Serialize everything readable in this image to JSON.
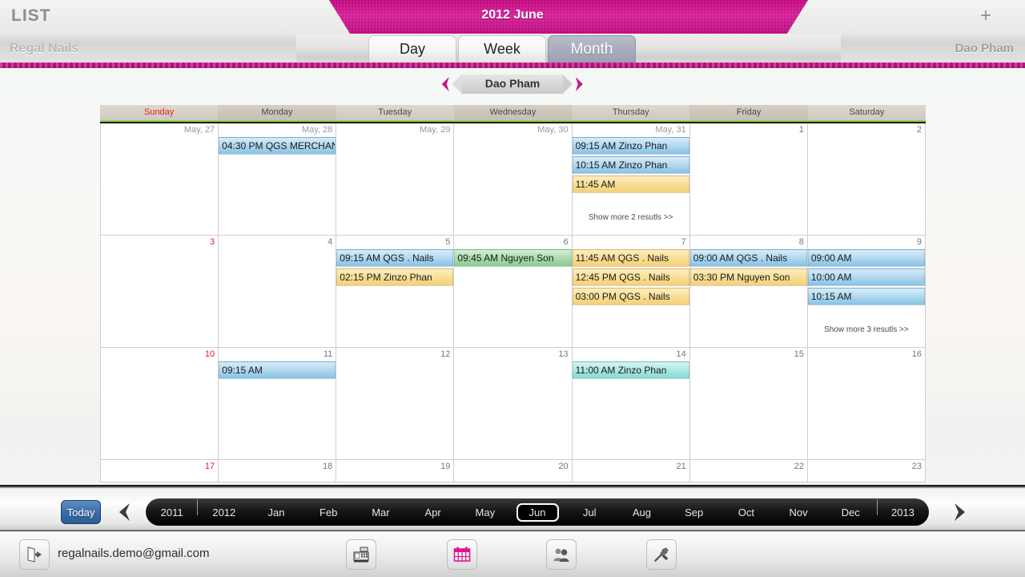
{
  "header": {
    "list_label": "LIST",
    "month_title": "2012 June",
    "add_label": "+",
    "brand": "Regal Nails",
    "user": "Dao Pham",
    "tabs": [
      {
        "label": "Day",
        "active": false
      },
      {
        "label": "Week",
        "active": false
      },
      {
        "label": "Month",
        "active": true
      }
    ]
  },
  "employee_nav": {
    "prev_icon": "chevron-left-icon",
    "next_icon": "chevron-right-icon",
    "name": "Dao Pham"
  },
  "calendar": {
    "day_headers": [
      "Sunday",
      "Monday",
      "Tuesday",
      "Wednesday",
      "Thursday",
      "Friday",
      "Saturday"
    ],
    "weeks": [
      {
        "days": [
          {
            "num": "May, 27",
            "style": "prev",
            "events": [],
            "more": null
          },
          {
            "num": "May, 28",
            "style": "prev",
            "events": [
              {
                "text": "04:30 PM QGS MERCHAN",
                "color": "blue"
              }
            ],
            "more": null
          },
          {
            "num": "May, 29",
            "style": "prev",
            "events": [],
            "more": null
          },
          {
            "num": "May, 30",
            "style": "prev",
            "events": [],
            "more": null
          },
          {
            "num": "May, 31",
            "style": "prev",
            "events": [
              {
                "text": "09:15 AM Zinzo Phan",
                "color": "blue"
              },
              {
                "text": "10:15 AM Zinzo Phan",
                "color": "blue"
              },
              {
                "text": "11:45 AM",
                "color": "yellow"
              }
            ],
            "more": "Show more 2 resutls >>"
          },
          {
            "num": "1",
            "style": "normal",
            "events": [],
            "more": null
          },
          {
            "num": "2",
            "style": "normal",
            "events": [],
            "more": null
          }
        ]
      },
      {
        "days": [
          {
            "num": "3",
            "style": "red",
            "events": [],
            "more": null
          },
          {
            "num": "4",
            "style": "normal",
            "events": [],
            "more": null
          },
          {
            "num": "5",
            "style": "normal",
            "events": [
              {
                "text": "09:15 AM QGS . Nails",
                "color": "blue"
              },
              {
                "text": "02:15 PM Zinzo Phan",
                "color": "yellow"
              }
            ],
            "more": null
          },
          {
            "num": "6",
            "style": "normal",
            "events": [
              {
                "text": "09:45 AM Nguyen Son",
                "color": "green"
              }
            ],
            "more": null
          },
          {
            "num": "7",
            "style": "normal",
            "events": [
              {
                "text": "11:45 AM QGS . Nails",
                "color": "yellow"
              },
              {
                "text": "12:45 PM QGS . Nails",
                "color": "yellow"
              },
              {
                "text": "03:00 PM QGS . Nails",
                "color": "yellow"
              }
            ],
            "more": null
          },
          {
            "num": "8",
            "style": "normal",
            "events": [
              {
                "text": "09:00 AM QGS . Nails",
                "color": "blue"
              },
              {
                "text": "03:30 PM Nguyen Son",
                "color": "yellow"
              }
            ],
            "more": null
          },
          {
            "num": "9",
            "style": "normal",
            "events": [
              {
                "text": "09:00 AM",
                "color": "blue"
              },
              {
                "text": "10:00 AM",
                "color": "blue"
              },
              {
                "text": "10:15 AM",
                "color": "blue"
              }
            ],
            "more": "Show more 3 resutls >>"
          }
        ]
      },
      {
        "days": [
          {
            "num": "10",
            "style": "red",
            "events": [],
            "more": null
          },
          {
            "num": "11",
            "style": "normal",
            "events": [
              {
                "text": "09:15 AM",
                "color": "blue"
              }
            ],
            "more": null
          },
          {
            "num": "12",
            "style": "normal",
            "events": [],
            "more": null
          },
          {
            "num": "13",
            "style": "normal",
            "events": [],
            "more": null
          },
          {
            "num": "14",
            "style": "normal",
            "events": [
              {
                "text": "11:00 AM Zinzo Phan",
                "color": "cyan"
              }
            ],
            "more": null
          },
          {
            "num": "15",
            "style": "normal",
            "events": [],
            "more": null
          },
          {
            "num": "16",
            "style": "normal",
            "events": [],
            "more": null
          }
        ]
      },
      {
        "days": [
          {
            "num": "17",
            "style": "red",
            "events": [],
            "more": null
          },
          {
            "num": "18",
            "style": "normal",
            "events": [],
            "more": null
          },
          {
            "num": "19",
            "style": "normal",
            "events": [],
            "more": null
          },
          {
            "num": "20",
            "style": "normal",
            "events": [],
            "more": null
          },
          {
            "num": "21",
            "style": "normal",
            "events": [],
            "more": null
          },
          {
            "num": "22",
            "style": "normal",
            "events": [],
            "more": null
          },
          {
            "num": "23",
            "style": "normal",
            "events": [],
            "more": null
          }
        ]
      }
    ]
  },
  "bottom_nav": {
    "today_label": "Today",
    "prev_icon": "chevron-left-icon",
    "next_icon": "chevron-right-icon",
    "items": [
      {
        "label": "2011",
        "selected": false,
        "kind": "year"
      },
      {
        "label": "2012",
        "selected": false,
        "kind": "year"
      },
      {
        "label": "Jan",
        "selected": false,
        "kind": "month"
      },
      {
        "label": "Feb",
        "selected": false,
        "kind": "month"
      },
      {
        "label": "Mar",
        "selected": false,
        "kind": "month"
      },
      {
        "label": "Apr",
        "selected": false,
        "kind": "month"
      },
      {
        "label": "May",
        "selected": false,
        "kind": "month"
      },
      {
        "label": "Jun",
        "selected": true,
        "kind": "month"
      },
      {
        "label": "Jul",
        "selected": false,
        "kind": "month"
      },
      {
        "label": "Aug",
        "selected": false,
        "kind": "month"
      },
      {
        "label": "Sep",
        "selected": false,
        "kind": "month"
      },
      {
        "label": "Oct",
        "selected": false,
        "kind": "month"
      },
      {
        "label": "Nov",
        "selected": false,
        "kind": "month"
      },
      {
        "label": "Dec",
        "selected": false,
        "kind": "month"
      },
      {
        "label": "2013",
        "selected": false,
        "kind": "year"
      }
    ]
  },
  "footer": {
    "logout_icon": "logout-door-icon",
    "email": "regalnails.demo@gmail.com",
    "icons": [
      {
        "name": "cash-register-icon"
      },
      {
        "name": "calendar-icon"
      },
      {
        "name": "customers-icon"
      },
      {
        "name": "tools-icon"
      }
    ]
  },
  "colors": {
    "accent_pink": "#c5128a",
    "event_blue": "#aed6ef",
    "event_yellow": "#f8dd93",
    "event_green": "#a8dbac",
    "event_cyan": "#a9e6e1",
    "sunday_red": "#e02020",
    "today_blue": "#3b6ea8"
  }
}
